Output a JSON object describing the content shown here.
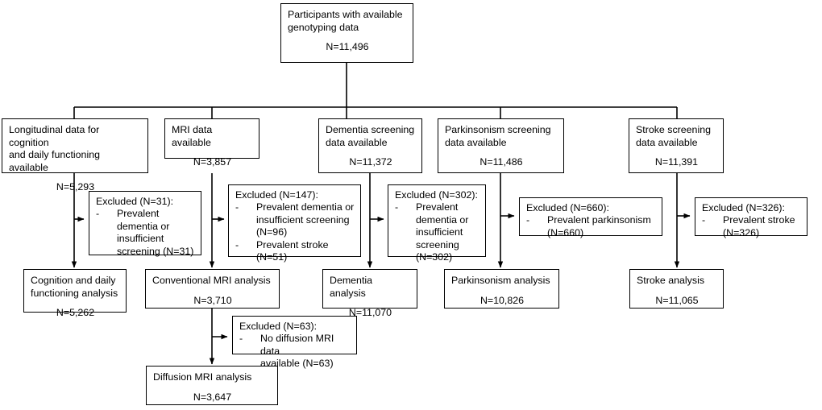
{
  "figure": {
    "type": "flowchart",
    "kind": "participant-flow-diagram",
    "line_color": "#000000",
    "background_color": "#ffffff",
    "text_color": "#000000"
  },
  "root": {
    "title": "Participants with available\ngenotyping data",
    "n": "N=11,496"
  },
  "branches": [
    {
      "id": "cognition",
      "title": "Longitudinal data for cognition\nand daily functioning available",
      "n": "N=5,293",
      "excluded": {
        "head": "Excluded (N=31):",
        "items": [
          "Prevalent\ndementia or\ninsufficient\nscreening (N=31)"
        ]
      },
      "analysis": {
        "title": "Cognition and daily\nfunctioning analysis",
        "n": "N=5,262"
      }
    },
    {
      "id": "mri",
      "title": "MRI data available",
      "n": "N=3,857",
      "excluded": {
        "head": "Excluded (N=147):",
        "items": [
          "Prevalent dementia or\ninsufficient screening\n(N=96)",
          "Prevalent stroke\n(N=51)"
        ]
      },
      "analysis": {
        "title": "Conventional MRI analysis",
        "n": "N=3,710"
      },
      "sub_excluded": {
        "head": "Excluded (N=63):",
        "items": [
          "No diffusion MRI data\navailable (N=63)"
        ]
      },
      "sub_analysis": {
        "title": "Diffusion MRI analysis",
        "n": "N=3,647"
      }
    },
    {
      "id": "dementia",
      "title": "Dementia screening\ndata available",
      "n": "N=11,372",
      "excluded": {
        "head": "Excluded (N=302):",
        "items": [
          "Prevalent\ndementia or\ninsufficient\nscreening\n(N=302)"
        ]
      },
      "analysis": {
        "title": "Dementia analysis",
        "n": "N=11,070"
      }
    },
    {
      "id": "parkinsonism",
      "title": "Parkinsonism screening\ndata available",
      "n": "N=11,486",
      "excluded": {
        "head": "Excluded (N=660):",
        "items": [
          "Prevalent parkinsonism\n(N=660)"
        ]
      },
      "analysis": {
        "title": "Parkinsonism analysis",
        "n": "N=10,826"
      }
    },
    {
      "id": "stroke",
      "title": "Stroke screening\ndata available",
      "n": "N=11,391",
      "excluded": {
        "head": "Excluded (N=326):",
        "items": [
          "Prevalent stroke\n(N=326)"
        ]
      },
      "analysis": {
        "title": "Stroke analysis",
        "n": "N=11,065"
      }
    }
  ],
  "bullet": "-"
}
